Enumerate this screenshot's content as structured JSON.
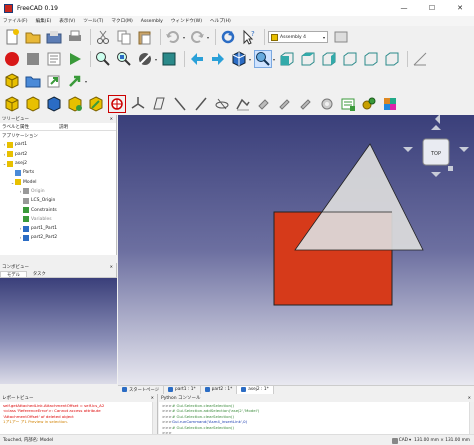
{
  "window": {
    "title": "FreeCAD 0.19",
    "minimize": "—",
    "maximize": "☐",
    "close": "✕"
  },
  "menu": [
    "ファイル(F)",
    "編集(E)",
    "表示(V)",
    "ツール(T)",
    "マクロ(M)",
    "Assembly",
    "ウィンドウ(W)",
    "ヘルプ(H)"
  ],
  "toolbar": {
    "workbench": "Assembly 4"
  },
  "tree_panel": {
    "title": "ツリービュー",
    "col_label": "ラベルと属性",
    "col_desc": "説明",
    "section": "アプリケーション",
    "items": [
      {
        "label": "part1",
        "indent": 0,
        "twisty": "›"
      },
      {
        "label": "part2",
        "indent": 0,
        "twisty": "›"
      },
      {
        "label": "asej2",
        "indent": 0,
        "twisty": "⌄"
      },
      {
        "label": "Parts",
        "indent": 1,
        "twisty": ""
      },
      {
        "label": "Model",
        "indent": 1,
        "twisty": "⌄"
      },
      {
        "label": "Origin",
        "indent": 2,
        "twisty": "›"
      },
      {
        "label": "LCS_Origin",
        "indent": 2,
        "twisty": ""
      },
      {
        "label": "Constraints",
        "indent": 2,
        "twisty": ""
      },
      {
        "label": "Variables",
        "indent": 2,
        "twisty": ""
      },
      {
        "label": "part1_Part1",
        "indent": 2,
        "twisty": "›"
      },
      {
        "label": "part2_Part2",
        "indent": 2,
        "twisty": "›"
      }
    ]
  },
  "combo_panel": {
    "title": "コンボビュー",
    "tabs": [
      "モデル",
      "タスク"
    ]
  },
  "view_tabs": [
    {
      "label": "スタートページ",
      "active": false
    },
    {
      "label": "part1 : 1*",
      "active": false
    },
    {
      "label": "part2 : 1*",
      "active": false
    },
    {
      "label": "asej2 : 1*",
      "active": true
    }
  ],
  "navcube": {
    "face": "TOP"
  },
  "report_panel": {
    "title": "レポートビュー",
    "lines": [
      {
        "text": "    self.getAttachedLink.AttachmentOffset = self.lcs_A2",
        "kind": "err"
      },
      {
        "text": "<class 'ReferenceError'>: Cannot access attribute",
        "kind": "err"
      },
      {
        "text": "'AttachmentOffset' of deleted object",
        "kind": "err"
      },
      {
        "text": "1ア1アー ア1 Preview in selection.",
        "kind": "warn"
      }
    ]
  },
  "python_panel": {
    "title": "Python コンソール",
    "lines": [
      {
        "prompt": ">>>",
        "text": "# Gui.Selection.clearSelection()",
        "kind": "green"
      },
      {
        "prompt": ">>>",
        "text": "# Gui.Selection.addSelection('asej2','Model')",
        "kind": "green"
      },
      {
        "prompt": ">>>",
        "text": "# Gui.Selection.clearSelection()",
        "kind": "green"
      },
      {
        "prompt": ">>>",
        "text": "Gui.runCommand('Asm4_insertLink',0)",
        "kind": "blue"
      },
      {
        "prompt": ">>>",
        "text": "# Gui.Selection.clearSelection()",
        "kind": "green"
      },
      {
        "prompt": ">>>",
        "text": "",
        "kind": "blue"
      }
    ]
  },
  "status": {
    "text": "Touched, 内部名: Model",
    "mode": "CAD",
    "size": "131.00 mm × 131.00 mm"
  },
  "colors": {
    "rectangle": "#d63a1a",
    "triangle": "#dcdcdc",
    "accent": "#2b6cc4"
  }
}
